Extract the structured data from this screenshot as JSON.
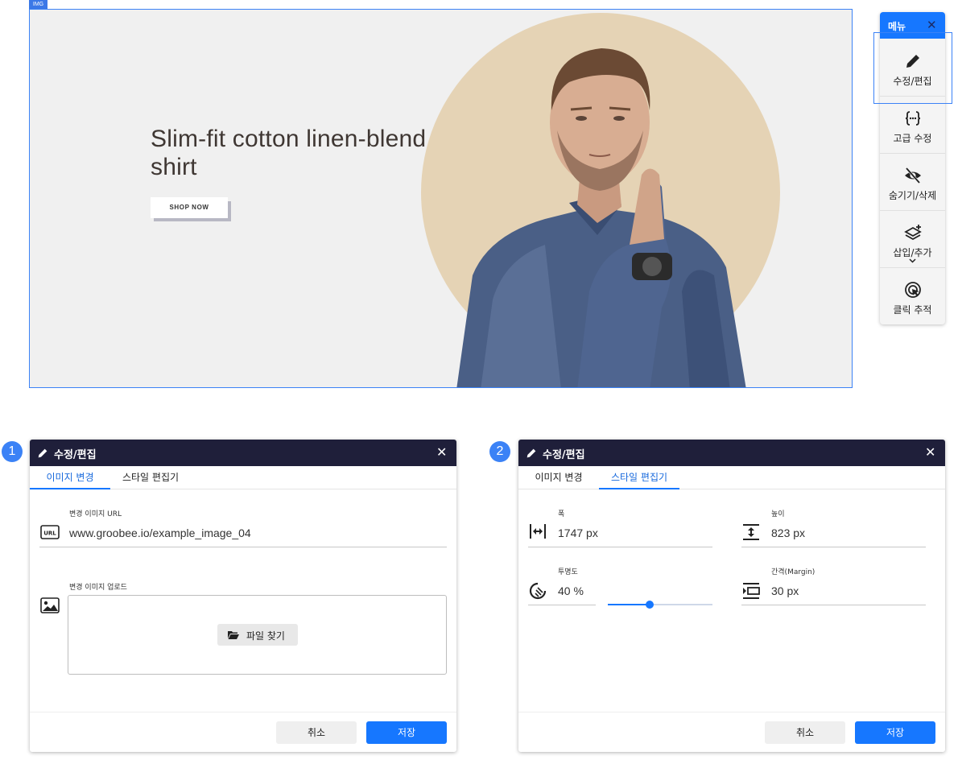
{
  "banner": {
    "tag": "IMG",
    "title": "Slim-fit cotton linen-blend shirt",
    "button": "SHOP NOW"
  },
  "menu": {
    "title": "메뉴",
    "close": "✕",
    "items": [
      {
        "label": "수정/편집",
        "icon": "pencil-icon"
      },
      {
        "label": "고급 수정",
        "icon": "code-braces-icon"
      },
      {
        "label": "숨기기/삭제",
        "icon": "eye-off-icon"
      },
      {
        "label": "삽입/추가",
        "icon": "layers-plus-icon"
      },
      {
        "label": "클릭 추적",
        "icon": "click-target-icon"
      }
    ]
  },
  "dialog1": {
    "step": "1",
    "title": "수정/편집",
    "close": "✕",
    "tabs": [
      "이미지 변경",
      "스타일 편집기"
    ],
    "active_tab": 0,
    "url_label": "변경 이미지 URL",
    "url_value": "www.groobee.io/example_image_04",
    "upload_label": "변경 이미지 업로드",
    "file_button": "파일 찾기",
    "cancel": "취소",
    "save": "저장"
  },
  "dialog2": {
    "step": "2",
    "title": "수정/편집",
    "close": "✕",
    "tabs": [
      "이미지 변경",
      "스타일 편집기"
    ],
    "active_tab": 1,
    "width_label": "폭",
    "width_value": "1747 px",
    "height_label": "높이",
    "height_value": "823 px",
    "opacity_label": "투명도",
    "opacity_value": "40 %",
    "opacity_slider": 0.4,
    "margin_label": "간격(Margin)",
    "margin_value": "30 px",
    "cancel": "취소",
    "save": "저장"
  },
  "colors": {
    "accent": "#1677ff",
    "header_dark": "#1f1f3a",
    "banner_bg": "#f0f0f0",
    "circle": "#e5d3b5"
  }
}
